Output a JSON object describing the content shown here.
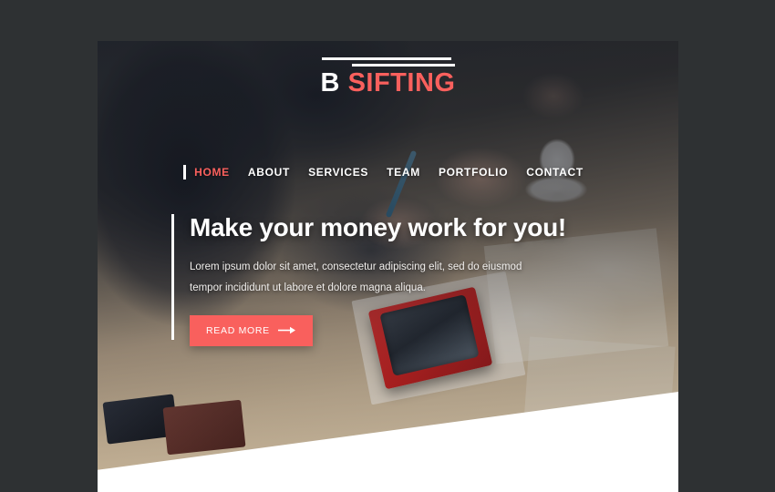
{
  "colors": {
    "backdrop": "#2e3133",
    "accent": "#f9605d",
    "text_light": "#ffffff",
    "wedge": "#ffffff"
  },
  "site": {
    "logo": {
      "primary": "B",
      "secondary": "SIFTING"
    },
    "nav": {
      "items": [
        {
          "label": "HOME",
          "active": true
        },
        {
          "label": "ABOUT",
          "active": false
        },
        {
          "label": "SERVICES",
          "active": false
        },
        {
          "label": "TEAM",
          "active": false
        },
        {
          "label": "PORTFOLIO",
          "active": false
        },
        {
          "label": "CONTACT",
          "active": false
        }
      ]
    },
    "hero": {
      "title": "Make your money work for you!",
      "subtitle": "Lorem ipsum dolor sit amet, consectetur adipiscing elit, sed do eiusmod tempor incididunt ut labore et dolore magna aliqua.",
      "cta_label": "READ MORE",
      "cta_icon": "arrow-right-icon",
      "background_image": "businessman-writing-at-desk-photo"
    }
  }
}
